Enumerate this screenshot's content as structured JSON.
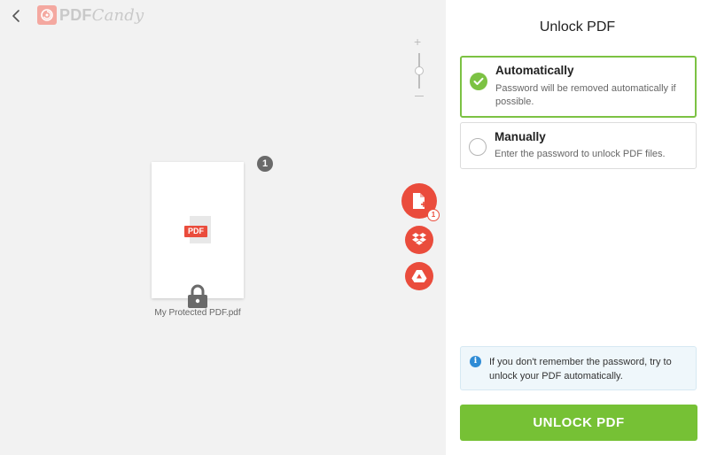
{
  "header": {
    "logo_text": "PDF",
    "logo_script": "Candy"
  },
  "workspace": {
    "zoom_plus": "+",
    "page_count": "1",
    "file": {
      "name": "My Protected PDF.pdf",
      "tag": "PDF"
    },
    "upload_badge": "1"
  },
  "panel": {
    "title": "Unlock PDF",
    "options": [
      {
        "label": "Automatically",
        "description": "Password will be removed automatically if possible.",
        "selected": true
      },
      {
        "label": "Manually",
        "description": "Enter the password to unlock PDF files.",
        "selected": false
      }
    ],
    "info_icon": "i",
    "info_text": "If you don't remember the password, try to unlock your PDF automatically.",
    "action_label": "UNLOCK PDF"
  },
  "colors": {
    "accent_green": "#76c135",
    "brand_red": "#ea4c3c",
    "info_blue": "#2f8cd6"
  },
  "icons": [
    "back-chevron-icon",
    "logo-icon",
    "pdf-file-icon",
    "lock-icon",
    "add-file-icon",
    "dropbox-icon",
    "google-drive-icon",
    "check-icon",
    "info-icon"
  ]
}
